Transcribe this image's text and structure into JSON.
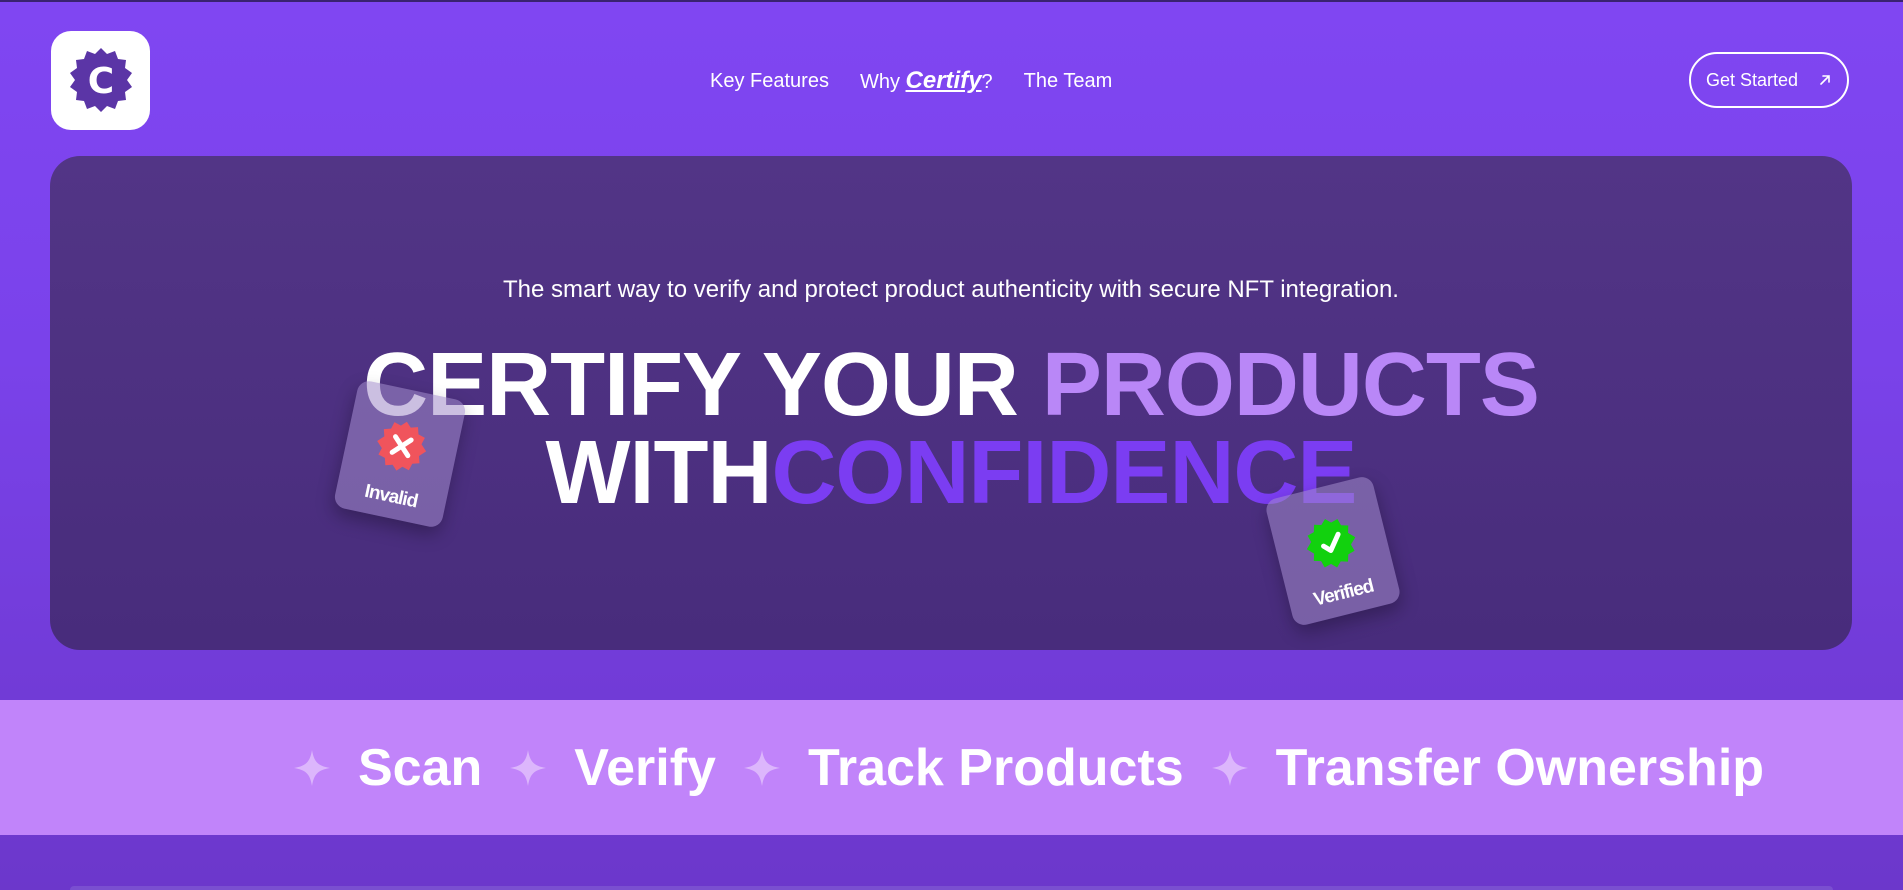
{
  "nav": {
    "logo_letter": "C",
    "links": {
      "key_features": "Key Features",
      "why_prefix": "Why ",
      "why_brand": "Certify",
      "why_suffix": "?",
      "team": "The Team"
    },
    "cta_label": "Get Started",
    "cta_icon": "arrow-up-right-icon"
  },
  "hero": {
    "subtitle": "The smart way to verify and protect product authenticity with secure NFT integration.",
    "headline": {
      "line1_white": "CERTIFY YOUR ",
      "line1_accent": "PRODUCTS",
      "line2_white": "WITH",
      "line2_accent": "CONFIDENCE"
    },
    "cards": {
      "invalid": {
        "label": "Invalid",
        "icon": "x-badge-icon",
        "color": "#f0545c"
      },
      "verified": {
        "label": "Verified",
        "icon": "check-badge-icon",
        "color": "#12d10e"
      }
    }
  },
  "band": {
    "items": [
      "Scan",
      "Verify",
      "Track Products",
      "Transfer Ownership"
    ],
    "separator_icon": "sparkle-icon"
  },
  "colors": {
    "page_bg": "#8046f2",
    "hero_bg": "#523586",
    "accent_light": "#b987f7",
    "accent_deep": "#7b3df2",
    "band_bg": "#c184fa"
  }
}
